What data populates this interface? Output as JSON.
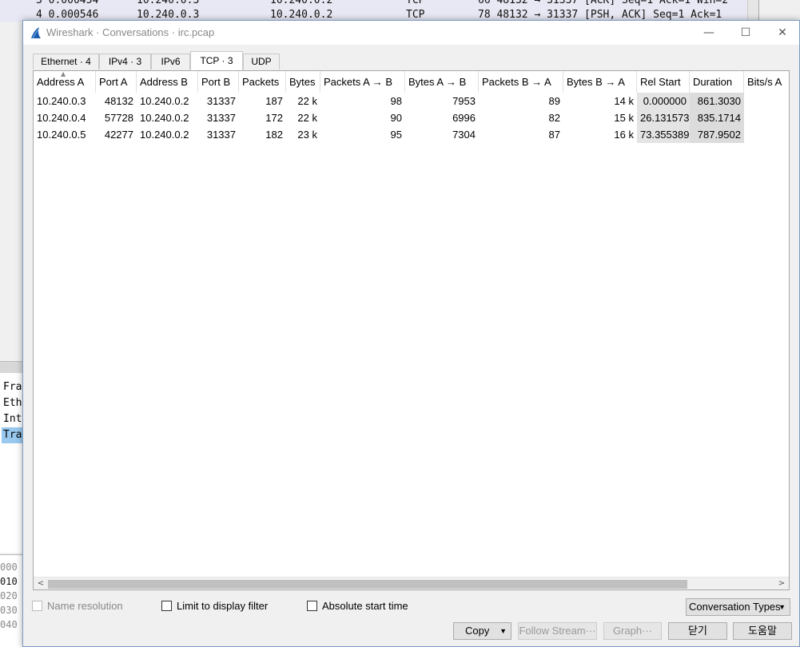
{
  "background": {
    "packet_rows": [
      {
        "no_time": "3 0.000454",
        "src": "10.240.0.3",
        "dst": "10.240.0.2",
        "proto": "TCP",
        "info": "66 48132 → 31337 [ACK] Seq=1 Ack=1 Win=2"
      },
      {
        "no_time": "4 0.000546",
        "src": "10.240.0.3",
        "dst": "10.240.0.2",
        "proto": "TCP",
        "info": "78 48132 → 31337 [PSH, ACK] Seq=1 Ack=1"
      }
    ],
    "detail_items": [
      "Fra",
      "Eth",
      "Int",
      "Tra"
    ],
    "hex_items": [
      "000",
      "010",
      "020",
      "030",
      "040"
    ]
  },
  "dialog": {
    "title": "Wireshark · Conversations · irc.pcap",
    "minimize": "—",
    "maximize": "☐",
    "close": "✕"
  },
  "tabs": [
    {
      "label": "Ethernet · 4"
    },
    {
      "label": "IPv4 · 3"
    },
    {
      "label": "IPv6"
    },
    {
      "label": "TCP · 3"
    },
    {
      "label": "UDP"
    }
  ],
  "table": {
    "columns": [
      "Address A",
      "Port A",
      "Address B",
      "Port B",
      "Packets",
      "Bytes",
      "Packets A → B",
      "Bytes A → B",
      "Packets B → A",
      "Bytes B → A",
      "Rel Start",
      "Duration",
      "Bits/s A"
    ],
    "rows": [
      [
        "10.240.0.3",
        "48132",
        "10.240.0.2",
        "31337",
        "187",
        "22 k",
        "98",
        "7953",
        "89",
        "14 k",
        "0.000000",
        "861.3030"
      ],
      [
        "10.240.0.4",
        "57728",
        "10.240.0.2",
        "31337",
        "172",
        "22 k",
        "90",
        "6996",
        "82",
        "15 k",
        "26.131573",
        "835.1714"
      ],
      [
        "10.240.0.5",
        "42277",
        "10.240.0.2",
        "31337",
        "182",
        "23 k",
        "95",
        "7304",
        "87",
        "16 k",
        "73.355389",
        "787.9502"
      ]
    ]
  },
  "options": {
    "name_resolution": "Name resolution",
    "limit_display_filter": "Limit to display filter",
    "absolute_start_time": "Absolute start time",
    "conversation_types": "Conversation Types"
  },
  "buttons": {
    "copy": "Copy",
    "follow_stream": "Follow Stream···",
    "graph": "Graph···",
    "close": "닫기",
    "help": "도움말"
  },
  "colors": {
    "accent_blue": "#1c5fb0",
    "selection": "#99c9ef"
  }
}
